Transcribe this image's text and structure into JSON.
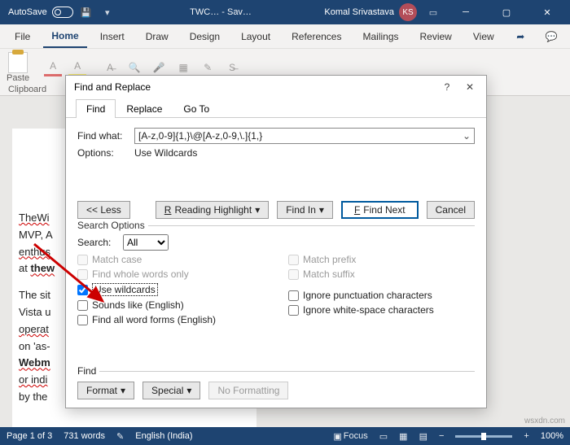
{
  "titlebar": {
    "autosave": "AutoSave",
    "doc": "TWC… - Sav…",
    "user": "Komal Srivastava",
    "initials": "KS"
  },
  "ribbon": {
    "tabs": {
      "file": "File",
      "home": "Home",
      "insert": "Insert",
      "draw": "Draw",
      "design": "Design",
      "layout": "Layout",
      "references": "References",
      "mailings": "Mailings",
      "review": "Review",
      "view": "View"
    },
    "paste": "Paste",
    "clipboard": "Clipboard"
  },
  "doc": {
    "p1a": "TheWi",
    "p1b": "MVP, A",
    "p1c": "enthus",
    "p1d": "at ",
    "p1d_bold": "thew",
    "p2a": "The sit",
    "p2b": "Vista u",
    "p2c": "operat",
    "p2d": "on 'as-",
    "p2e": "Webm",
    "p2f": "or indi",
    "p2g": "by the"
  },
  "dialog": {
    "title": "Find and Replace",
    "tabs": {
      "find": "Find",
      "replace": "Replace",
      "goto": "Go To"
    },
    "findwhat_label": "Find what:",
    "findwhat_value": "[A-z,0-9]{1,}\\@[A-z,0-9,\\.]{1,}",
    "options_label": "Options:",
    "options_value": "Use Wildcards",
    "less": "<< Less",
    "reading_highlight": "Reading Highlight",
    "find_in": "Find In",
    "find_next": "Find Next",
    "cancel": "Cancel",
    "search_options": "Search Options",
    "search_label": "Search:",
    "search_value": "All",
    "match_case": "Match case",
    "whole_words": "Find whole words only",
    "use_wildcards": "Use wildcards",
    "sounds_like": "Sounds like (English)",
    "all_word_forms": "Find all word forms (English)",
    "match_prefix": "Match prefix",
    "match_suffix": "Match suffix",
    "ignore_punct": "Ignore punctuation characters",
    "ignore_ws": "Ignore white-space characters",
    "find_section": "Find",
    "format": "Format",
    "special": "Special",
    "no_formatting": "No Formatting"
  },
  "status": {
    "page": "Page 1 of 3",
    "words": "731 words",
    "lang": "English (India)",
    "focus": "Focus",
    "zoom": "100%"
  },
  "watermark": "wsxdn.com"
}
